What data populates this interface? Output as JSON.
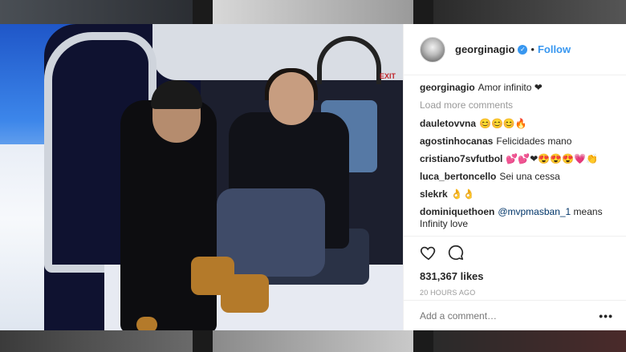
{
  "post": {
    "username": "georginagio",
    "follow_label": "Follow",
    "separator": "•",
    "caption": {
      "user": "georginagio",
      "text": "Amor infinito ❤"
    },
    "load_more": "Load more comments",
    "comments": [
      {
        "user": "dauletovvna",
        "text": "😊😊😊🔥"
      },
      {
        "user": "agostinhocanas",
        "text": "Felicidades mano"
      },
      {
        "user": "cristiano7svfutbol",
        "text": "💕💕❤😍😍😍💗👏"
      },
      {
        "user": "luca_bertoncello",
        "text": "Sei una cessa"
      },
      {
        "user": "slekrk",
        "text": "👌👌"
      },
      {
        "user": "dominiquethoen",
        "mention": "@mvpmasban_1",
        "text": " means Infinity love"
      }
    ],
    "likes": "831,367 likes",
    "time_ago": "20 HOURS AGO",
    "comment_placeholder": "Add a comment…",
    "more_label": "•••"
  },
  "photo": {
    "sign_text": "EXIT"
  },
  "icons": {
    "like": "heart-icon",
    "comment": "comment-bubble-icon",
    "verified": "verified-badge-icon"
  },
  "colors": {
    "accent": "#3897f0",
    "text": "#262626",
    "muted": "#999999"
  }
}
